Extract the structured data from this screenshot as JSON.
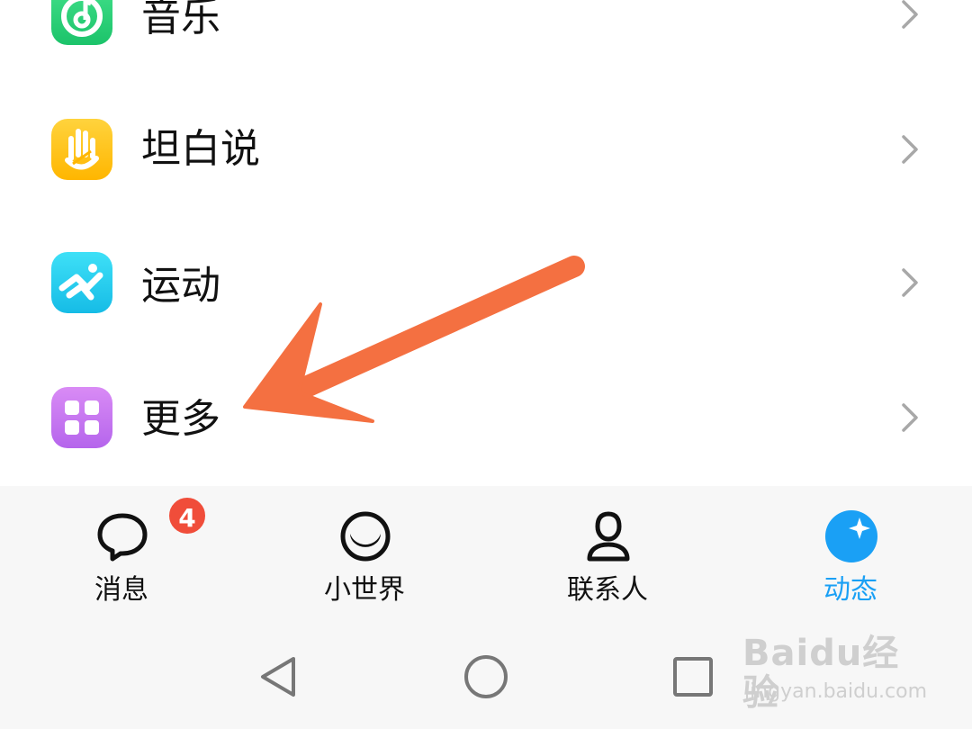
{
  "menu": {
    "items": [
      {
        "label": "音乐",
        "icon": "music-app-icon"
      },
      {
        "label": "坦白说",
        "icon": "hand-app-icon"
      },
      {
        "label": "运动",
        "icon": "running-app-icon"
      },
      {
        "label": "更多",
        "icon": "grid-app-icon"
      }
    ]
  },
  "tabbar": {
    "tabs": [
      {
        "label": "消息",
        "icon": "chat-bubble-icon",
        "badge": "4"
      },
      {
        "label": "小世界",
        "icon": "small-world-icon"
      },
      {
        "label": "联系人",
        "icon": "contact-person-icon"
      },
      {
        "label": "动态",
        "icon": "star-circle-icon",
        "active": true
      }
    ]
  },
  "navbar": {
    "buttons": [
      "back-icon",
      "home-icon",
      "recents-icon"
    ]
  },
  "watermark": {
    "brand": "Baidu经验",
    "url": "jingyan.baidu.com"
  },
  "colors": {
    "accent": "#1aa0f5",
    "arrow": "#f47041",
    "badge": "#f04d3a"
  }
}
